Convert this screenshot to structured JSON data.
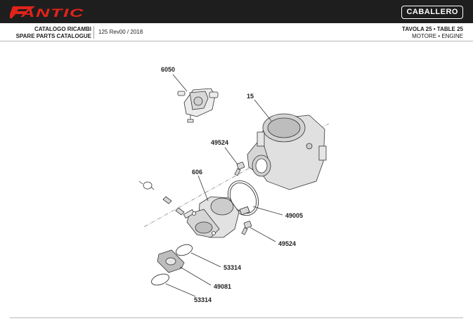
{
  "header": {
    "brand_logo_text": "FANTIC",
    "brand_color": "#e2231a",
    "model_badge": "CABALLERO",
    "catalogue_title_it": "CATALOGO RICAMBI",
    "catalogue_title_en": "SPARE PARTS CATALOGUE",
    "edition": "125 Rev00 / 2018",
    "table_title": "TAVOLA 25 • TABLE 25",
    "section_title": "MOTORE • ENGINE"
  },
  "diagram": {
    "part_labels": {
      "p6050": "6050",
      "p15": "15",
      "p49524_top": "49524",
      "p606": "606",
      "p49005": "49005",
      "p49524_bottom": "49524",
      "p53314_top": "53314",
      "p49081": "49081",
      "p53314_bottom": "53314"
    }
  }
}
